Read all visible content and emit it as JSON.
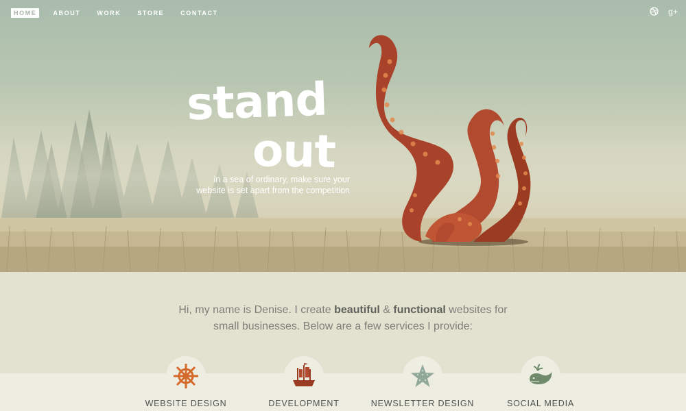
{
  "nav": {
    "items": [
      {
        "label": "HOME",
        "active": true
      },
      {
        "label": "ABOUT",
        "active": false
      },
      {
        "label": "WORK",
        "active": false
      },
      {
        "label": "STORE",
        "active": false
      },
      {
        "label": "CONTACT",
        "active": false
      }
    ],
    "social": [
      {
        "icon": "dribbble-icon",
        "glyph": "◎"
      },
      {
        "icon": "google-plus-icon",
        "glyph": "g+"
      }
    ]
  },
  "hero": {
    "headline_line1": "stand",
    "headline_line2": "out",
    "tagline_line1": "in a sea of ordinary, make sure your",
    "tagline_line2": "website is set apart from the competition"
  },
  "intro": {
    "part1": "Hi, my name is Denise. I create ",
    "bold1": "beautiful",
    "part2": " & ",
    "bold2": "functional",
    "part3": " websites for",
    "line2": "small businesses. Below are a few services I provide:"
  },
  "services": [
    {
      "label": "WEBSITE DESIGN",
      "icon": "ship-wheel-icon",
      "color": "#d4692a"
    },
    {
      "label": "DEVELOPMENT",
      "icon": "pirate-ship-icon",
      "color": "#9a3b22"
    },
    {
      "label": "NEWSLETTER DESIGN",
      "icon": "starfish-icon",
      "color": "#8fa898"
    },
    {
      "label": "SOCIAL MEDIA",
      "icon": "whale-icon",
      "color": "#6f8a6b"
    }
  ],
  "colors": {
    "tentacle": "#a8422a",
    "sucker": "#e38a4e",
    "text_dark": "#4e504c",
    "sky": "#a9bcac"
  }
}
